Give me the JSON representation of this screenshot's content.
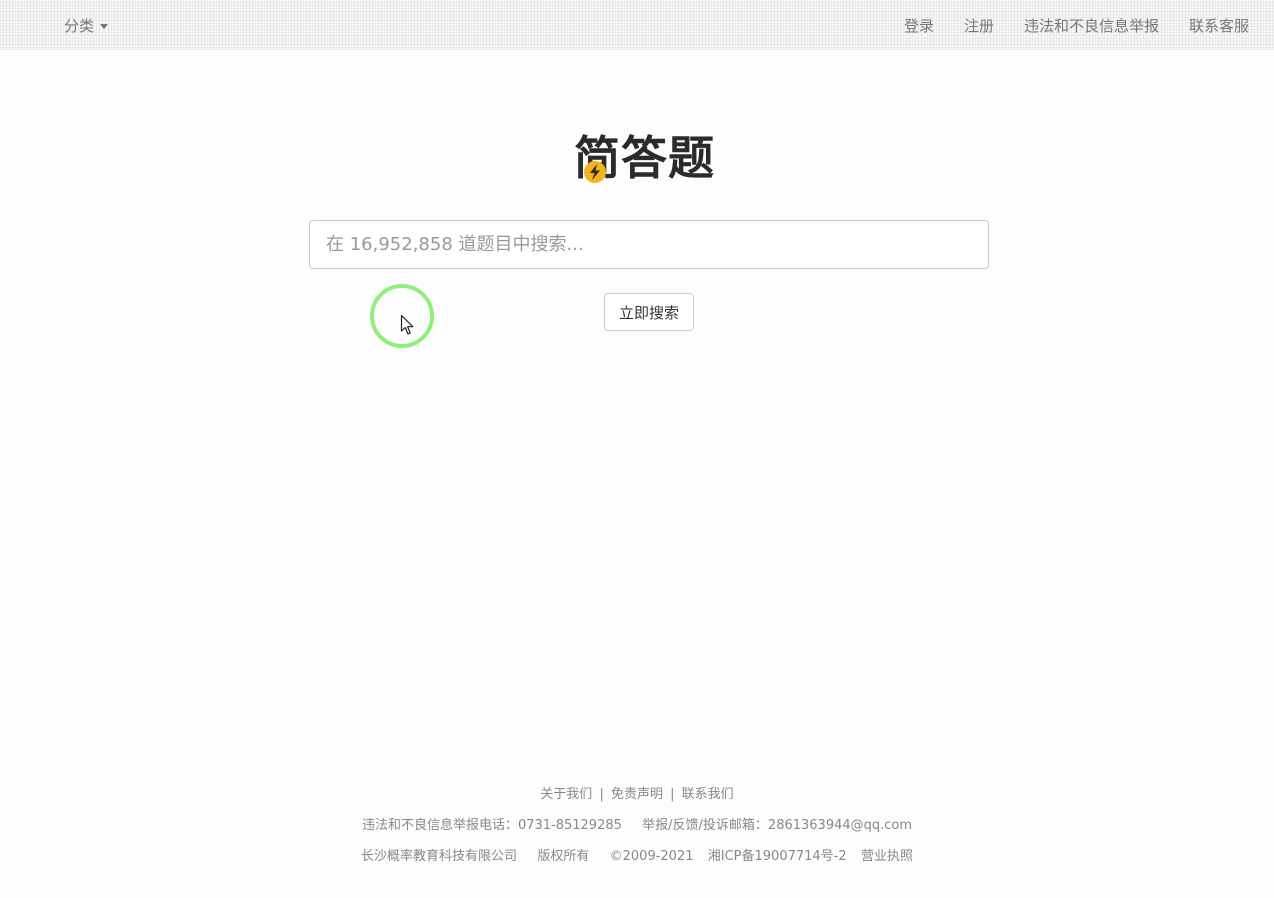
{
  "nav": {
    "category_label": "分类",
    "links": [
      "登录",
      "注册",
      "违法和不良信息举报",
      "联系客服"
    ]
  },
  "logo": {
    "text": "简答题",
    "accent_color": "#f5b41a"
  },
  "search": {
    "placeholder": "在 16,952,858 道题目中搜索...",
    "value": "",
    "button_label": "立即搜索"
  },
  "footer": {
    "links": [
      "关于我们",
      "免责声明",
      "联系我们"
    ],
    "separator": "|",
    "report_phone_label": "违法和不良信息举报电话：0731-85129285",
    "report_email_label": "举报/反馈/投诉邮箱：2861363944@qq.com",
    "company": "长沙概率教育科技有限公司",
    "rights": "版权所有",
    "years": "©2009-2021",
    "icp": "湘ICP备19007714号-2",
    "license": "营业执照"
  },
  "cursor": {
    "highlight_color": "#8ef07a",
    "icon": "pointer-arrow-icon"
  }
}
